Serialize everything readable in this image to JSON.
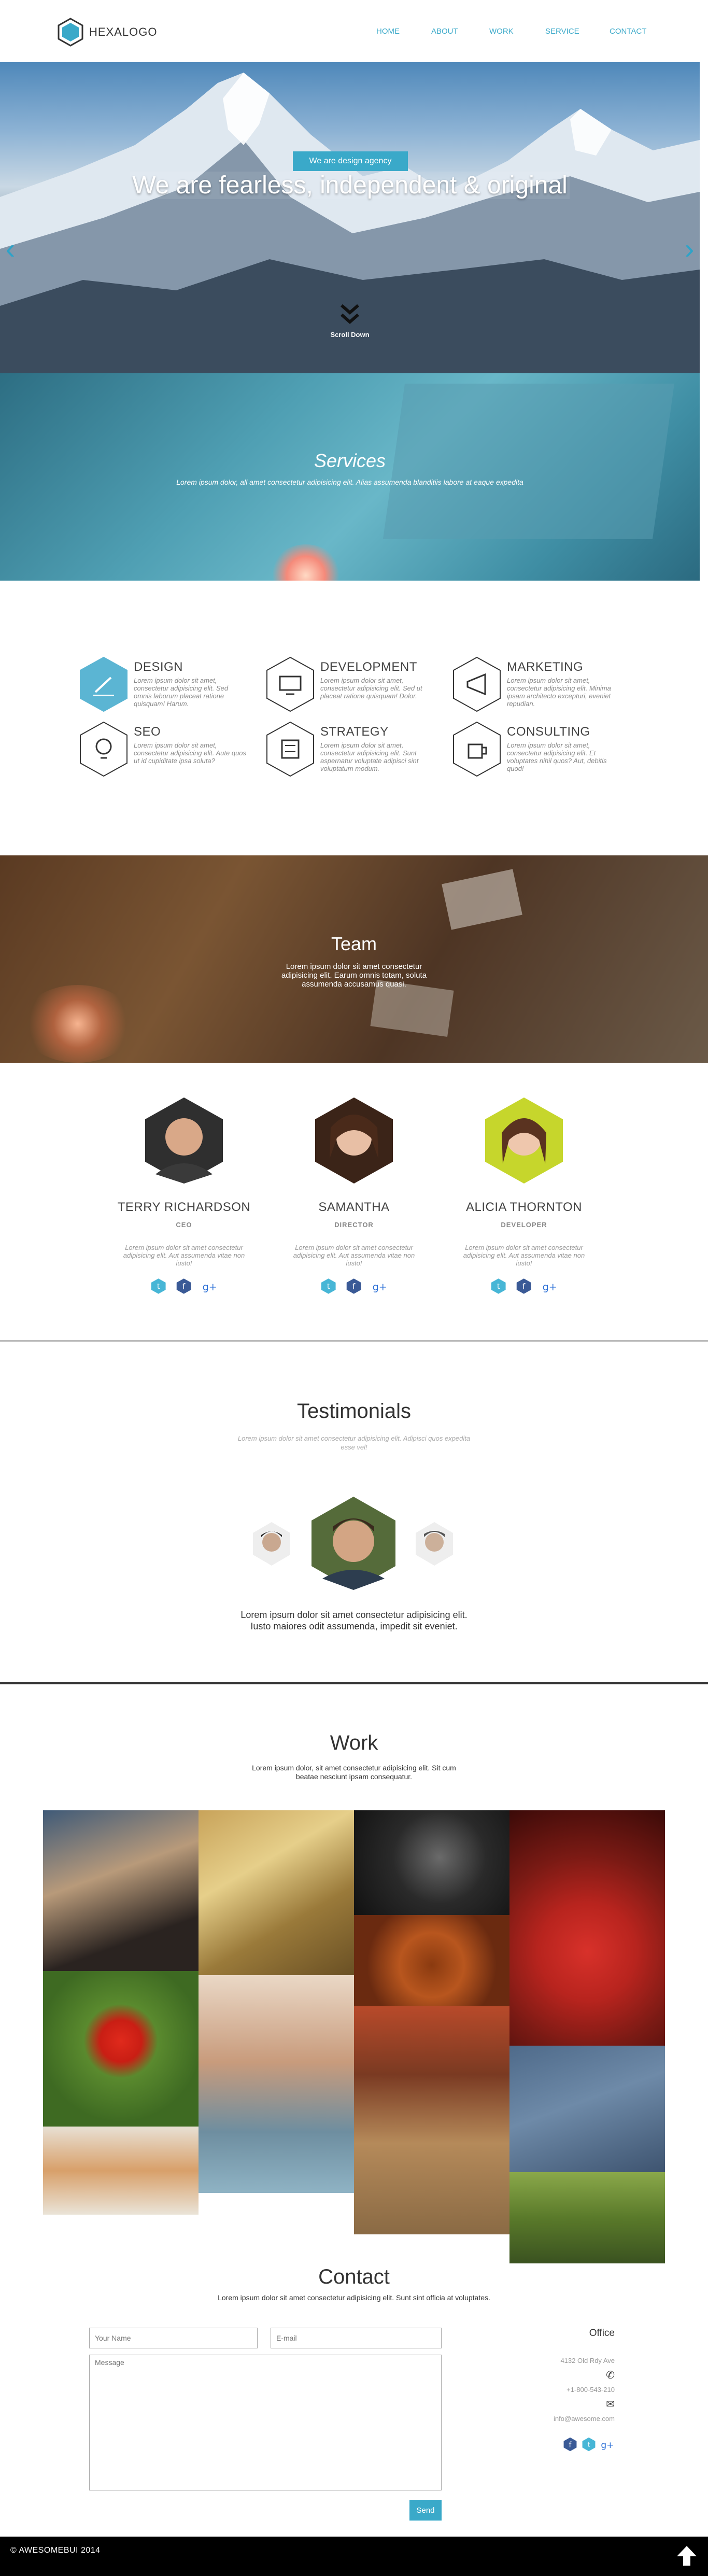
{
  "header": {
    "logo_text": "HEXALOGO",
    "nav": [
      "HOME",
      "ABOUT",
      "WORK",
      "SERVICE",
      "CONTACT"
    ]
  },
  "hero": {
    "badge": "We are design agency",
    "title": "We are fearless, independent & original",
    "scroll_label": "Scroll Down"
  },
  "services_banner": {
    "title": "Services",
    "subtitle": "Lorem ipsum dolor, all amet consectetur adipisicing elit. Alias assumenda blanditiis labore at eaque expedita"
  },
  "services": [
    {
      "title": "DESIGN",
      "icon": "pencil-icon",
      "text": "Lorem ipsum dolor sit amet, consectetur adipisicing elit. Sed omnis laborum placeat ratione quisquam! Harum."
    },
    {
      "title": "DEVELOPMENT",
      "icon": "monitor-code-icon",
      "text": "Lorem ipsum dolor sit amet, consectetur adipisicing elit. Sed ut placeat ratione quisquam! Dolor."
    },
    {
      "title": "MARKETING",
      "icon": "megaphone-icon",
      "text": "Lorem ipsum dolor sit amet, consectetur adipisicing elit. Minima ipsam architecto excepturi, eveniet repudian."
    },
    {
      "title": "SEO",
      "icon": "lightbulb-icon",
      "text": "Lorem ipsum dolor sit amet, consectetur adipisicing elit. Aute quos ut id cupiditate ipsa soluta?"
    },
    {
      "title": "STRATEGY",
      "icon": "calculator-icon",
      "text": "Lorem ipsum dolor sit amet, consectetur adipisicing elit. Sunt aspernatur voluptate adipisci sint voluptatum modum."
    },
    {
      "title": "CONSULTING",
      "icon": "coffee-cup-icon",
      "text": "Lorem ipsum dolor sit amet, consectetur adipisicing elit. Et voluptates nihil quos? Aut, debitis quod!"
    }
  ],
  "team_banner": {
    "title": "Team",
    "subtitle": "Lorem ipsum dolor sit amet consectetur adipisicing elit. Earum omnis totam, soluta assumenda accusamus quasi."
  },
  "team": [
    {
      "name": "TERRY RICHARDSON",
      "role": "CEO",
      "bio": "Lorem ipsum dolor sit amet consectetur adipisicing elit. Aut assumenda vitae non iusto!"
    },
    {
      "name": "SAMANTHA",
      "role": "DIRECTOR",
      "bio": "Lorem ipsum dolor sit amet consectetur adipisicing elit. Aut assumenda vitae non iusto!"
    },
    {
      "name": "ALICIA THORNTON",
      "role": "DEVELOPER",
      "bio": "Lorem ipsum dolor sit amet consectetur adipisicing elit. Aut assumenda vitae non iusto!"
    }
  ],
  "social_icons": [
    "twitter-icon",
    "facebook-icon",
    "google-plus-icon"
  ],
  "testimonials": {
    "title": "Testimonials",
    "subtitle": "Lorem ipsum dolor sit amet consectetur adipisicing elit. Adipisci quos expedita esse vel!",
    "quote": "Lorem ipsum dolor sit amet consectetur adipisicing elit. Iusto maiores odit assumenda, impedit sit eveniet."
  },
  "work": {
    "title": "Work",
    "subtitle": "Lorem ipsum dolor, sit amet consectetur adipisicing elit. Sit cum beatae nesciunt ipsam consequatur."
  },
  "contact": {
    "title": "Contact",
    "subtitle": "Lorem ipsum dolor sit amet consectetur adipisicing elit. Sunt sint officia at voluptates.",
    "name_placeholder": "Your Name",
    "email_placeholder": "E-mail",
    "message_placeholder": "Message",
    "send_label": "Send",
    "office_title": "Office",
    "address": "4132 Old Rdy Ave",
    "phone": "+1-800-543-210",
    "email": "info@awesome.com"
  },
  "footer": {
    "copyright": "© AWESOMEBUI 2014"
  },
  "colors": {
    "accent": "#3aa9c9",
    "footer": "#000000"
  }
}
